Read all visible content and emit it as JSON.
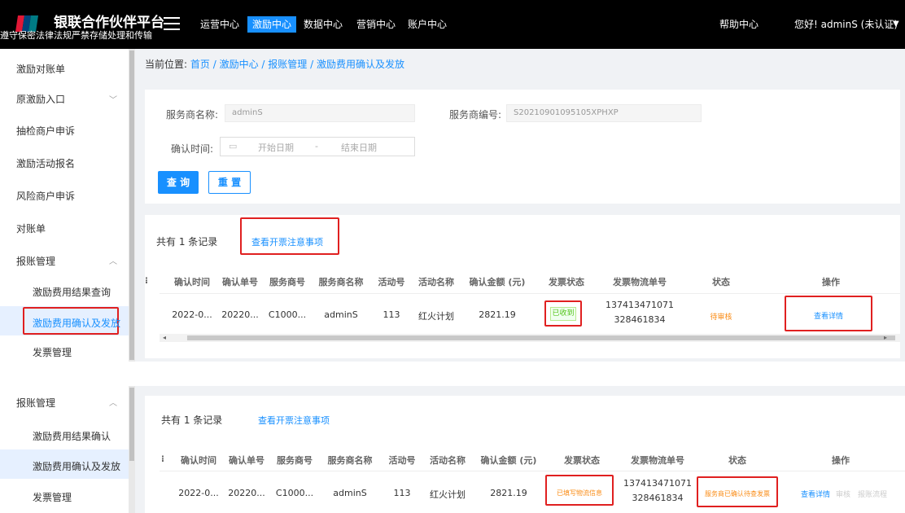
{
  "header": {
    "brand": "银联合作伙伴平台",
    "subtitle": "遵守保密法律法规严禁存储处理和传输",
    "nav": [
      "运营中心",
      "激励中心",
      "数据中心",
      "营销中心",
      "账户中心"
    ],
    "help": "帮助中心",
    "user": "您好! adminS (未认证)",
    "colors": {
      "accent": "#1890ff",
      "topbar": "#000000"
    }
  },
  "sidebar": {
    "items": [
      "激励对账单",
      "原激励入口",
      "抽检商户申诉",
      "激励活动报名",
      "风险商户申诉",
      "对账单",
      "报账管理"
    ],
    "sub_items": [
      "激励费用结果查询",
      "激励费用确认及发放",
      "发票管理"
    ]
  },
  "sidebar2": {
    "group": "报账管理",
    "sub_items": [
      "激励费用结果确认",
      "激励费用确认及发放",
      "发票管理"
    ]
  },
  "breadcrumb": {
    "prefix": "当前位置:",
    "items": [
      "首页",
      "激励中心",
      "报账管理",
      "激励费用确认及发放"
    ],
    "sep": " / "
  },
  "search": {
    "provider_name_label": "服务商名称:",
    "provider_name_value": "adminS",
    "provider_no_label": "服务商编号:",
    "provider_no_value": "S20210901095105XPHXP",
    "confirm_time_label": "确认时间:",
    "start_placeholder": "开始日期",
    "range_sep": "-",
    "end_placeholder": "结束日期",
    "query_button": "查 询",
    "reset_button": "重 置"
  },
  "table1": {
    "records": "共有 1 条记录",
    "notice_link": "查看开票注意事项",
    "columns": [
      "确认时间",
      "确认单号",
      "服务商号",
      "服务商名称",
      "活动号",
      "活动名称",
      "确认金额 (元)",
      "发票状态",
      "发票物流单号",
      "状态",
      "操作"
    ],
    "row": {
      "time": "2022-0...",
      "confirm_no": "20220...",
      "provider_no": "C1000...",
      "provider_name": "adminS",
      "activity_no": "113",
      "activity_name": "红火计划",
      "amount": "2821.19",
      "invoice_status": "已收到",
      "logistics_1": "137413471071",
      "logistics_2": "328461834",
      "status": "待审核",
      "action": "查看详情"
    }
  },
  "table2": {
    "records": "共有 1 条记录",
    "notice_link": "查看开票注意事项",
    "columns": [
      "确认时间",
      "确认单号",
      "服务商号",
      "服务商名称",
      "活动号",
      "活动名称",
      "确认金额 (元)",
      "发票状态",
      "发票物流单号",
      "状态",
      "操作"
    ],
    "row": {
      "time": "2022-0...",
      "confirm_no": "20220...",
      "provider_no": "C1000...",
      "provider_name": "adminS",
      "activity_no": "113",
      "activity_name": "红火计划",
      "amount": "2821.19",
      "invoice_status": "已填写物流信息",
      "logistics_1": "137413471071",
      "logistics_2": "328461834",
      "status": "服务商已确认待查发票",
      "action": "查看详情",
      "action_2": "审核",
      "action_3": "报账流程"
    }
  }
}
